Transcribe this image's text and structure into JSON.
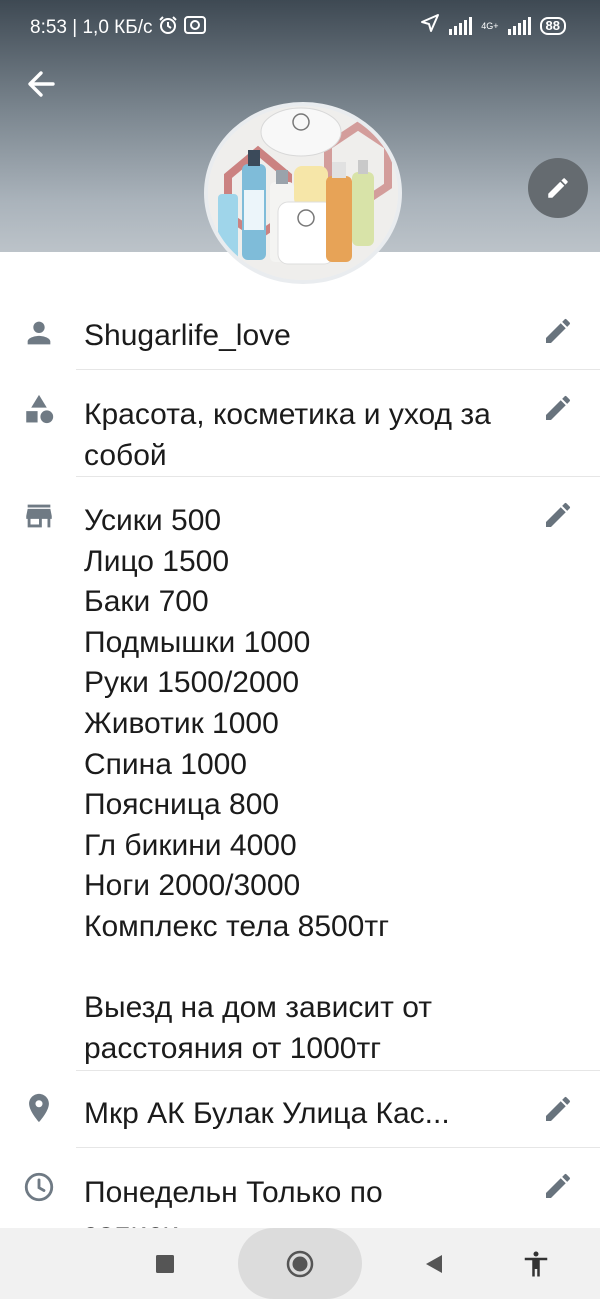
{
  "status_bar": {
    "time_info": "8:53 | 1,0 КБ/с",
    "network": "4G+",
    "battery": "88"
  },
  "profile": {
    "name": "Shugarlife_love",
    "category": "Красота, косметика и уход за собой",
    "description": "Усики 500\nЛицо 1500\nБаки 700\nПодмышки 1000\nРуки 1500/2000\nЖивотик 1000\nСпина 1000\nПоясница 800\nГл бикини 4000\nНоги 2000/3000\nКомплекс тела 8500тг\n\nВыезд на дом зависит от расстояния от 1000тг",
    "address": "Мкр АК Булак Улица Кас...",
    "hours": "Понедельн Только по\nзаписи"
  },
  "icons": {
    "back": "arrow-left-icon",
    "edit": "pencil-icon",
    "name": "person-icon",
    "category": "shapes-icon",
    "description": "store-icon",
    "address": "location-pin-icon",
    "hours": "clock-icon"
  },
  "colors": {
    "icon": "#6f7a84",
    "edit": "#68737d"
  }
}
